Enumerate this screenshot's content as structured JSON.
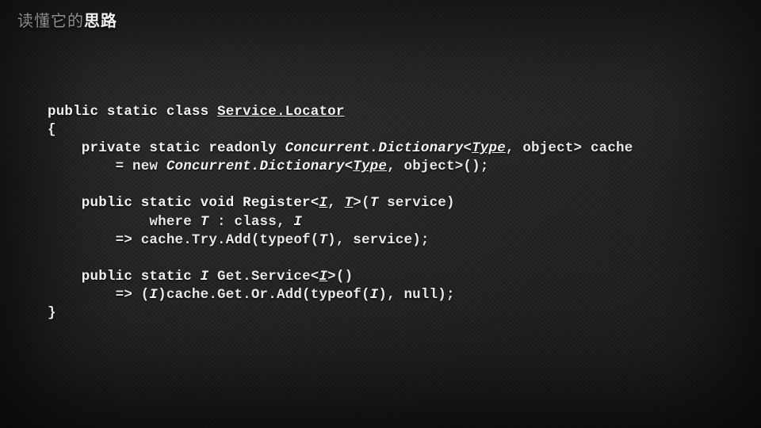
{
  "title": {
    "dim": "读懂它的",
    "bright": "思路"
  },
  "code": {
    "l1": {
      "a": "public static class ",
      "b": "Service.Locator"
    },
    "l2": "{",
    "l3": {
      "a": "    private static readonly ",
      "b": "Concurrent.Dictionary",
      "c": "<",
      "d": "Type",
      "e": ", object> cache"
    },
    "l4": {
      "a": "        = new ",
      "b": "Concurrent.Dictionary",
      "c": "<",
      "d": "Type",
      "e": ", object>();"
    },
    "l5": "",
    "l6": {
      "a": "    public static void Register<",
      "b": "I",
      "c": ", ",
      "d": "T",
      "e": ">(",
      "f": "T",
      "g": " service)"
    },
    "l7": {
      "a": "            where ",
      "b": "T",
      "c": " : class, ",
      "d": "I"
    },
    "l8": {
      "a": "        => cache.Try.Add(typeof(",
      "b": "T",
      "c": "), service);"
    },
    "l9": "",
    "l10": {
      "a": "    public static ",
      "b": "I",
      "c": " Get.Service<",
      "d": "I",
      "e": ">()"
    },
    "l11": {
      "a": "        => (",
      "b": "I",
      "c": ")cache.Get.Or.Add(typeof(",
      "d": "I",
      "e": "), null);"
    },
    "l12": "}"
  }
}
